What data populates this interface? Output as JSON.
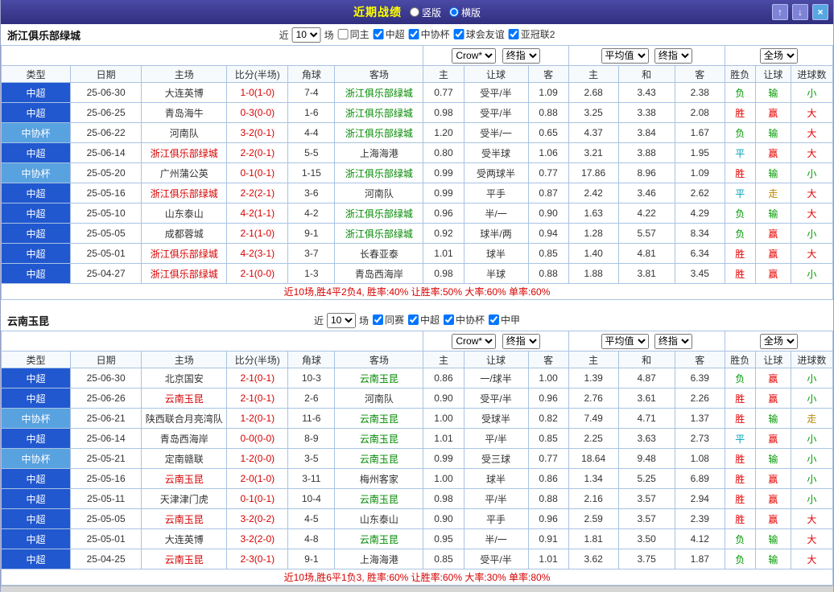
{
  "titlebar": {
    "title": "近期战绩",
    "radio_vertical": "竖版",
    "radio_horizontal": "横版",
    "selected": "横版",
    "buttons": {
      "up": "↑",
      "down": "↓",
      "close": "×"
    }
  },
  "colors": {
    "accent_bar": "#33327f",
    "title_text": "#ffff00",
    "league_super": "#2158d0",
    "league_cup": "#58a2e0",
    "win_red": "#e60000",
    "lose_green": "#009900",
    "draw_teal": "#00a0b4",
    "push_olive": "#bb8800"
  },
  "sections": [
    {
      "team": "浙江俱乐部绿城",
      "filter": {
        "near_label": "近",
        "count": "10",
        "games_label": "场",
        "checkboxes": [
          {
            "label": "同主",
            "checked": false
          },
          {
            "label": "中超",
            "checked": true
          },
          {
            "label": "中协杯",
            "checked": true
          },
          {
            "label": "球会友谊",
            "checked": true
          },
          {
            "label": "亚冠联2",
            "checked": true
          }
        ]
      },
      "selects": {
        "bookmaker": "Crow*",
        "final1": "终指",
        "average": "平均值",
        "final2": "终指",
        "scope": "全场"
      },
      "columns": [
        "类型",
        "日期",
        "主场",
        "比分(半场)",
        "角球",
        "客场",
        "主",
        "让球",
        "客",
        "主",
        "和",
        "客",
        "胜负",
        "让球",
        "进球数"
      ],
      "rows": [
        {
          "type": "中超",
          "type_cls": "lg-super",
          "date": "25-06-30",
          "home": "大连英博",
          "home_cls": "",
          "score": "1-0(1-0)",
          "corner": "7-4",
          "away": "浙江俱乐部绿城",
          "away_cls": "tm-away",
          "o1h": "0.77",
          "o1l": "受平/半",
          "o1a": "1.09",
          "o2h": "2.68",
          "o2d": "3.43",
          "o2a": "2.38",
          "r1": "负",
          "r1c": "res-lose",
          "r2": "输",
          "r2c": "res-lose",
          "r3": "小",
          "r3c": "res-lose"
        },
        {
          "type": "中超",
          "type_cls": "lg-super",
          "date": "25-06-25",
          "home": "青岛海牛",
          "home_cls": "",
          "score": "0-3(0-0)",
          "corner": "1-6",
          "away": "浙江俱乐部绿城",
          "away_cls": "tm-away",
          "o1h": "0.98",
          "o1l": "受平/半",
          "o1a": "0.88",
          "o2h": "3.25",
          "o2d": "3.38",
          "o2a": "2.08",
          "r1": "胜",
          "r1c": "res-win",
          "r2": "赢",
          "r2c": "res-win",
          "r3": "大",
          "r3c": "res-win"
        },
        {
          "type": "中协杯",
          "type_cls": "lg-cup",
          "date": "25-06-22",
          "home": "河南队",
          "home_cls": "",
          "score": "3-2(0-1)",
          "corner": "4-4",
          "away": "浙江俱乐部绿城",
          "away_cls": "tm-away",
          "o1h": "1.20",
          "o1l": "受半/一",
          "o1a": "0.65",
          "o2h": "4.37",
          "o2d": "3.84",
          "o2a": "1.67",
          "r1": "负",
          "r1c": "res-lose",
          "r2": "输",
          "r2c": "res-lose",
          "r3": "大",
          "r3c": "res-win"
        },
        {
          "type": "中超",
          "type_cls": "lg-super",
          "date": "25-06-14",
          "home": "浙江俱乐部绿城",
          "home_cls": "tm-home",
          "score": "2-2(0-1)",
          "corner": "5-5",
          "away": "上海海港",
          "away_cls": "",
          "o1h": "0.80",
          "o1l": "受半球",
          "o1a": "1.06",
          "o2h": "3.21",
          "o2d": "3.88",
          "o2a": "1.95",
          "r1": "平",
          "r1c": "res-draw",
          "r2": "赢",
          "r2c": "res-win",
          "r3": "大",
          "r3c": "res-win"
        },
        {
          "type": "中协杯",
          "type_cls": "lg-cup",
          "date": "25-05-20",
          "home": "广州蒲公英",
          "home_cls": "",
          "score": "0-1(0-1)",
          "corner": "1-15",
          "away": "浙江俱乐部绿城",
          "away_cls": "tm-away",
          "o1h": "0.99",
          "o1l": "受两球半",
          "o1a": "0.77",
          "o2h": "17.86",
          "o2d": "8.96",
          "o2a": "1.09",
          "r1": "胜",
          "r1c": "res-win",
          "r2": "输",
          "r2c": "res-lose",
          "r3": "小",
          "r3c": "res-lose"
        },
        {
          "type": "中超",
          "type_cls": "lg-super",
          "date": "25-05-16",
          "home": "浙江俱乐部绿城",
          "home_cls": "tm-home",
          "score": "2-2(2-1)",
          "corner": "3-6",
          "away": "河南队",
          "away_cls": "",
          "o1h": "0.99",
          "o1l": "平手",
          "o1a": "0.87",
          "o2h": "2.42",
          "o2d": "3.46",
          "o2a": "2.62",
          "r1": "平",
          "r1c": "res-draw",
          "r2": "走",
          "r2c": "res-push",
          "r3": "大",
          "r3c": "res-win"
        },
        {
          "type": "中超",
          "type_cls": "lg-super",
          "date": "25-05-10",
          "home": "山东泰山",
          "home_cls": "",
          "score": "4-2(1-1)",
          "corner": "4-2",
          "away": "浙江俱乐部绿城",
          "away_cls": "tm-away",
          "o1h": "0.96",
          "o1l": "半/一",
          "o1a": "0.90",
          "o2h": "1.63",
          "o2d": "4.22",
          "o2a": "4.29",
          "r1": "负",
          "r1c": "res-lose",
          "r2": "输",
          "r2c": "res-lose",
          "r3": "大",
          "r3c": "res-win"
        },
        {
          "type": "中超",
          "type_cls": "lg-super",
          "date": "25-05-05",
          "home": "成都蓉城",
          "home_cls": "",
          "score": "2-1(1-0)",
          "corner": "9-1",
          "away": "浙江俱乐部绿城",
          "away_cls": "tm-away",
          "o1h": "0.92",
          "o1l": "球半/两",
          "o1a": "0.94",
          "o2h": "1.28",
          "o2d": "5.57",
          "o2a": "8.34",
          "r1": "负",
          "r1c": "res-lose",
          "r2": "赢",
          "r2c": "res-win",
          "r3": "小",
          "r3c": "res-lose"
        },
        {
          "type": "中超",
          "type_cls": "lg-super",
          "date": "25-05-01",
          "home": "浙江俱乐部绿城",
          "home_cls": "tm-home",
          "score": "4-2(3-1)",
          "corner": "3-7",
          "away": "长春亚泰",
          "away_cls": "",
          "o1h": "1.01",
          "o1l": "球半",
          "o1a": "0.85",
          "o2h": "1.40",
          "o2d": "4.81",
          "o2a": "6.34",
          "r1": "胜",
          "r1c": "res-win",
          "r2": "赢",
          "r2c": "res-win",
          "r3": "大",
          "r3c": "res-win"
        },
        {
          "type": "中超",
          "type_cls": "lg-super",
          "date": "25-04-27",
          "home": "浙江俱乐部绿城",
          "home_cls": "tm-home",
          "score": "2-1(0-0)",
          "corner": "1-3",
          "away": "青岛西海岸",
          "away_cls": "",
          "o1h": "0.98",
          "o1l": "半球",
          "o1a": "0.88",
          "o2h": "1.88",
          "o2d": "3.81",
          "o2a": "3.45",
          "r1": "胜",
          "r1c": "res-win",
          "r2": "赢",
          "r2c": "res-win",
          "r3": "小",
          "r3c": "res-lose"
        }
      ],
      "summary": "近10场,胜4平2负4, 胜率:40% 让胜率:50% 大率:60% 单率:60%"
    },
    {
      "team": "云南玉昆",
      "filter": {
        "near_label": "近",
        "count": "10",
        "games_label": "场",
        "checkboxes": [
          {
            "label": "同赛",
            "checked": true
          },
          {
            "label": "中超",
            "checked": true
          },
          {
            "label": "中协杯",
            "checked": true
          },
          {
            "label": "中甲",
            "checked": true
          }
        ]
      },
      "selects": {
        "bookmaker": "Crow*",
        "final1": "终指",
        "average": "平均值",
        "final2": "终指",
        "scope": "全场"
      },
      "columns": [
        "类型",
        "日期",
        "主场",
        "比分(半场)",
        "角球",
        "客场",
        "主",
        "让球",
        "客",
        "主",
        "和",
        "客",
        "胜负",
        "让球",
        "进球数"
      ],
      "rows": [
        {
          "type": "中超",
          "type_cls": "lg-super",
          "date": "25-06-30",
          "home": "北京国安",
          "home_cls": "",
          "score": "2-1(0-1)",
          "corner": "10-3",
          "away": "云南玉昆",
          "away_cls": "tm-away",
          "o1h": "0.86",
          "o1l": "一/球半",
          "o1a": "1.00",
          "o2h": "1.39",
          "o2d": "4.87",
          "o2a": "6.39",
          "r1": "负",
          "r1c": "res-lose",
          "r2": "赢",
          "r2c": "res-win",
          "r3": "小",
          "r3c": "res-lose"
        },
        {
          "type": "中超",
          "type_cls": "lg-super",
          "date": "25-06-26",
          "home": "云南玉昆",
          "home_cls": "tm-home",
          "score": "2-1(0-1)",
          "corner": "2-6",
          "away": "河南队",
          "away_cls": "",
          "o1h": "0.90",
          "o1l": "受平/半",
          "o1a": "0.96",
          "o2h": "2.76",
          "o2d": "3.61",
          "o2a": "2.26",
          "r1": "胜",
          "r1c": "res-win",
          "r2": "赢",
          "r2c": "res-win",
          "r3": "小",
          "r3c": "res-lose"
        },
        {
          "type": "中协杯",
          "type_cls": "lg-cup",
          "date": "25-06-21",
          "home": "陕西联合月亮湾队",
          "home_cls": "",
          "score": "1-2(0-1)",
          "corner": "11-6",
          "away": "云南玉昆",
          "away_cls": "tm-away",
          "o1h": "1.00",
          "o1l": "受球半",
          "o1a": "0.82",
          "o2h": "7.49",
          "o2d": "4.71",
          "o2a": "1.37",
          "r1": "胜",
          "r1c": "res-win",
          "r2": "输",
          "r2c": "res-lose",
          "r3": "走",
          "r3c": "res-push"
        },
        {
          "type": "中超",
          "type_cls": "lg-super",
          "date": "25-06-14",
          "home": "青岛西海岸",
          "home_cls": "",
          "score": "0-0(0-0)",
          "corner": "8-9",
          "away": "云南玉昆",
          "away_cls": "tm-away",
          "o1h": "1.01",
          "o1l": "平/半",
          "o1a": "0.85",
          "o2h": "2.25",
          "o2d": "3.63",
          "o2a": "2.73",
          "r1": "平",
          "r1c": "res-draw",
          "r2": "赢",
          "r2c": "res-win",
          "r3": "小",
          "r3c": "res-lose"
        },
        {
          "type": "中协杯",
          "type_cls": "lg-cup",
          "date": "25-05-21",
          "home": "定南赣联",
          "home_cls": "",
          "score": "1-2(0-0)",
          "corner": "3-5",
          "away": "云南玉昆",
          "away_cls": "tm-away",
          "o1h": "0.99",
          "o1l": "受三球",
          "o1a": "0.77",
          "o2h": "18.64",
          "o2d": "9.48",
          "o2a": "1.08",
          "r1": "胜",
          "r1c": "res-win",
          "r2": "输",
          "r2c": "res-lose",
          "r3": "小",
          "r3c": "res-lose"
        },
        {
          "type": "中超",
          "type_cls": "lg-super",
          "date": "25-05-16",
          "home": "云南玉昆",
          "home_cls": "tm-home",
          "score": "2-0(1-0)",
          "corner": "3-11",
          "away": "梅州客家",
          "away_cls": "",
          "o1h": "1.00",
          "o1l": "球半",
          "o1a": "0.86",
          "o2h": "1.34",
          "o2d": "5.25",
          "o2a": "6.89",
          "r1": "胜",
          "r1c": "res-win",
          "r2": "赢",
          "r2c": "res-win",
          "r3": "小",
          "r3c": "res-lose"
        },
        {
          "type": "中超",
          "type_cls": "lg-super",
          "date": "25-05-11",
          "home": "天津津门虎",
          "home_cls": "",
          "score": "0-1(0-1)",
          "corner": "10-4",
          "away": "云南玉昆",
          "away_cls": "tm-away",
          "o1h": "0.98",
          "o1l": "平/半",
          "o1a": "0.88",
          "o2h": "2.16",
          "o2d": "3.57",
          "o2a": "2.94",
          "r1": "胜",
          "r1c": "res-win",
          "r2": "赢",
          "r2c": "res-win",
          "r3": "小",
          "r3c": "res-lose"
        },
        {
          "type": "中超",
          "type_cls": "lg-super",
          "date": "25-05-05",
          "home": "云南玉昆",
          "home_cls": "tm-home",
          "score": "3-2(0-2)",
          "corner": "4-5",
          "away": "山东泰山",
          "away_cls": "",
          "o1h": "0.90",
          "o1l": "平手",
          "o1a": "0.96",
          "o2h": "2.59",
          "o2d": "3.57",
          "o2a": "2.39",
          "r1": "胜",
          "r1c": "res-win",
          "r2": "赢",
          "r2c": "res-win",
          "r3": "大",
          "r3c": "res-win"
        },
        {
          "type": "中超",
          "type_cls": "lg-super",
          "date": "25-05-01",
          "home": "大连英博",
          "home_cls": "",
          "score": "3-2(2-0)",
          "corner": "4-8",
          "away": "云南玉昆",
          "away_cls": "tm-away",
          "o1h": "0.95",
          "o1l": "半/一",
          "o1a": "0.91",
          "o2h": "1.81",
          "o2d": "3.50",
          "o2a": "4.12",
          "r1": "负",
          "r1c": "res-lose",
          "r2": "输",
          "r2c": "res-lose",
          "r3": "大",
          "r3c": "res-win"
        },
        {
          "type": "中超",
          "type_cls": "lg-super",
          "date": "25-04-25",
          "home": "云南玉昆",
          "home_cls": "tm-home",
          "score": "2-3(0-1)",
          "corner": "9-1",
          "away": "上海海港",
          "away_cls": "",
          "o1h": "0.85",
          "o1l": "受平/半",
          "o1a": "1.01",
          "o2h": "3.62",
          "o2d": "3.75",
          "o2a": "1.87",
          "r1": "负",
          "r1c": "res-lose",
          "r2": "输",
          "r2c": "res-lose",
          "r3": "大",
          "r3c": "res-win"
        }
      ],
      "summary": "近10场,胜6平1负3, 胜率:60% 让胜率:60% 大率:30% 单率:80%"
    }
  ]
}
